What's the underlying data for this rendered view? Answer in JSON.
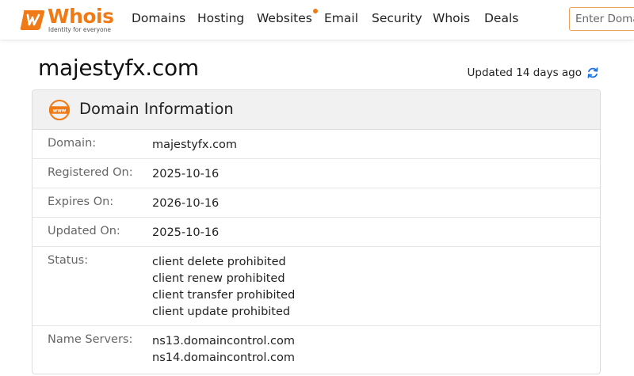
{
  "header": {
    "logo_word": "Whois",
    "logo_tagline": "Identity for everyone",
    "nav": [
      {
        "label": "Domains"
      },
      {
        "label": "Hosting"
      },
      {
        "label": "Websites"
      },
      {
        "label": "Email"
      },
      {
        "label": "Security"
      },
      {
        "label": "Whois"
      },
      {
        "label": "Deals"
      }
    ],
    "search_placeholder": "Enter Domain or IP"
  },
  "page": {
    "title": "majestyfx.com",
    "updated": "Updated 14 days ago"
  },
  "card": {
    "title": "Domain Information",
    "rows": [
      {
        "label": "Domain:",
        "values": [
          "majestyfx.com"
        ]
      },
      {
        "label": "Registered On:",
        "values": [
          "2025-10-16"
        ]
      },
      {
        "label": "Expires On:",
        "values": [
          "2026-10-16"
        ]
      },
      {
        "label": "Updated On:",
        "values": [
          "2025-10-16"
        ]
      },
      {
        "label": "Status:",
        "values": [
          "client delete prohibited",
          "client renew prohibited",
          "client transfer prohibited",
          "client update prohibited"
        ]
      },
      {
        "label": "Name Servers:",
        "values": [
          "ns13.domaincontrol.com",
          "ns14.domaincontrol.com"
        ]
      }
    ]
  },
  "colors": {
    "brand": "#f07b16",
    "header_bg": "#f1f1f1",
    "label": "#666666"
  },
  "icons": [
    "whois-logo-icon",
    "new-dot-icon",
    "refresh-icon",
    "www-globe-icon"
  ]
}
